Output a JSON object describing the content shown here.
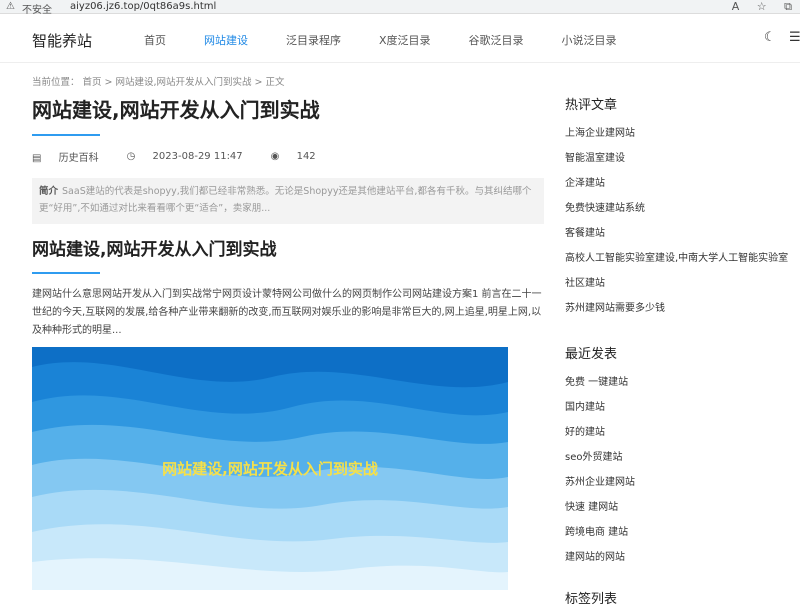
{
  "browser": {
    "insecure_label": "不安全",
    "url": "aiyz06.jz6.top/0qt86a9s.html"
  },
  "header": {
    "logo": "智能养站",
    "nav": [
      {
        "label": "首页"
      },
      {
        "label": "网站建设",
        "active": true
      },
      {
        "label": "泛目录程序"
      },
      {
        "label": "X度泛目录"
      },
      {
        "label": "谷歌泛目录"
      },
      {
        "label": "小说泛目录"
      }
    ]
  },
  "breadcrumb": "当前位置：  首页 > 网站建设,网站开发从入门到实战 > 正文",
  "post": {
    "title": "网站建设,网站开发从入门到实战",
    "category": "历史百科",
    "date": "2023-08-29 11:47",
    "views": "142",
    "summary_label": "简介",
    "summary": "SaaS建站的代表是shopyy,我们都已经非常熟悉。无论是Shopyy还是其他建站平台,都各有千秋。与其纠结哪个更“好用”,不如通过对比来看看哪个更“适合”，卖家朋...",
    "h2": "网站建设,网站开发从入门到实战",
    "body": "建网站什么意思网站开发从入门到实战常宁网页设计蒙特网公司做什么的网页制作公司网站建设方案1 前言在二十一世纪的今天,互联网的发展,给各种产业带来翻新的改变,而互联网对娱乐业的影响是非常巨大的,网上追星,明星上网,以及种种形式的明星...",
    "hero_text": "网站建设,网站开发从入门到实战"
  },
  "sidebar": {
    "hot_title": "热评文章",
    "hot": [
      "上海企业建网站",
      "智能温室建设",
      "企泽建站",
      "免费快速建站系统",
      "客餐建站",
      "高校人工智能实验室建设,中南大学人工智能实验室",
      "社区建站",
      "苏州建网站需要多少钱"
    ],
    "recent_title": "最近发表",
    "recent": [
      "免费 一键建站",
      "国内建站",
      "好的建站",
      "seo外贸建站",
      "苏州企业建网站",
      "快速 建网站",
      "跨境电商 建站",
      "建网站的网站"
    ],
    "tags_title": "标签列表"
  },
  "icons": {
    "warning": "warning-icon",
    "reader": "reader-mode-icon",
    "favorite": "favorite-star-icon",
    "tabs": "tab-actions-icon",
    "theme": "moon-icon",
    "menu": "menu-icon",
    "category": "folder-icon",
    "time": "clock-icon",
    "views": "eye-icon"
  },
  "colors": {
    "accent": "#1e88e5",
    "underline": "#2f9cf0",
    "hero_text": "#f5e04a"
  }
}
